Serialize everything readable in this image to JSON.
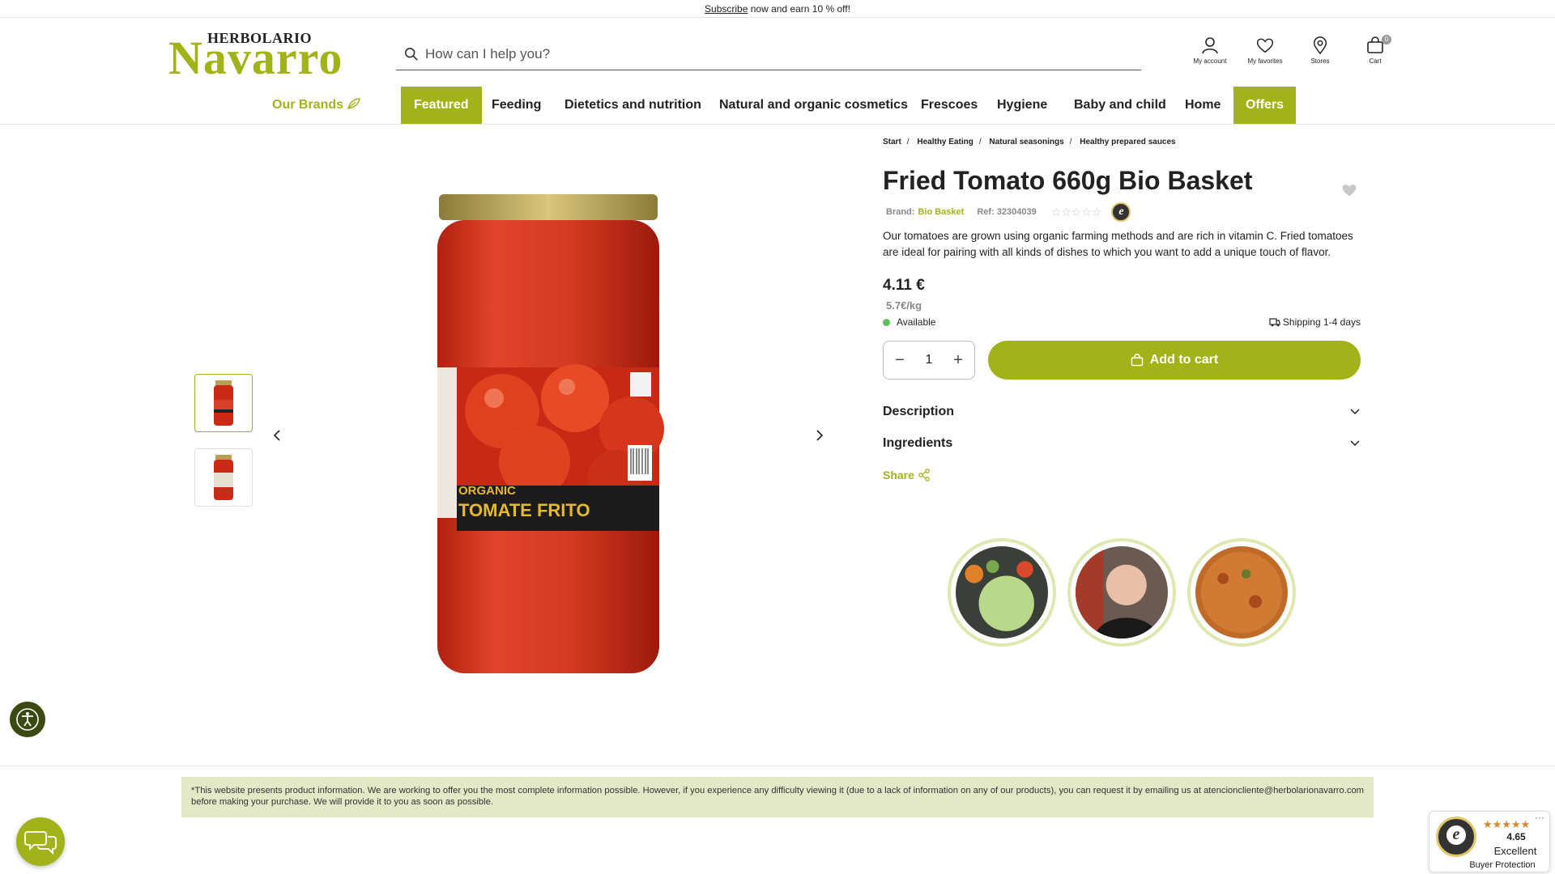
{
  "topbar": {
    "link": "Subscribe",
    "text": " now and earn 10 % off!"
  },
  "logo": {
    "small": "HERBOLARIO",
    "big": "Navarro"
  },
  "search": {
    "placeholder": "How can I help you?"
  },
  "header_icons": [
    {
      "label": "My account",
      "icon": "user-icon"
    },
    {
      "label": "My favorites",
      "icon": "heart-icon"
    },
    {
      "label": "Stores",
      "icon": "location-pin-icon"
    },
    {
      "label": "Cart",
      "icon": "bag-icon",
      "badge": "0"
    }
  ],
  "nav": {
    "brands": "Our Brands",
    "items": [
      "Featured",
      "Feeding",
      "Dietetics and nutrition",
      "Natural and organic cosmetics",
      "Frescoes",
      "Hygiene",
      "Baby and child",
      "Home",
      "Offers"
    ]
  },
  "breadcrumb": [
    "Start",
    "Healthy Eating",
    "Natural seasonings",
    "Healthy prepared sauces"
  ],
  "product": {
    "title": "Fried Tomato 660g Bio Basket",
    "brand_label": "Brand:",
    "brand": "Bio Basket",
    "ref": "Ref: 32304039",
    "rating_stars": "☆☆☆☆☆",
    "rating_value": 0,
    "description": "Our tomatoes are grown using organic farming methods and are rich in vitamin C. Fried tomatoes are ideal for pairing with all kinds of dishes to which you want to add a unique touch of flavor.",
    "price": "4.11 €",
    "price_per_kg": "5.7€/kg",
    "availability": "Available",
    "shipping": "Shipping 1-4 days",
    "quantity": "1",
    "add_to_cart": "Add to cart",
    "accordions": [
      "Description",
      "Ingredients"
    ],
    "share": "Share",
    "jar_label_top": "ORGANIC",
    "jar_label_main": "TOMATE FRITO"
  },
  "notice": "*This website presents product information. We are working to offer you the most complete information possible. However, if you experience any difficulty viewing it (due to a lack of information on any of our products), you can request it by emailing us at atencioncliente@herbolarionavarro.com before making your purchase. We will provide it to you as soon as possible.",
  "trusted": {
    "score": "4.65",
    "level": "Excellent",
    "protection": "Buyer Protection",
    "stars": "★★★★★"
  },
  "colors": {
    "accent": "#a2b31a",
    "notice_bg": "#e3e8c6"
  }
}
